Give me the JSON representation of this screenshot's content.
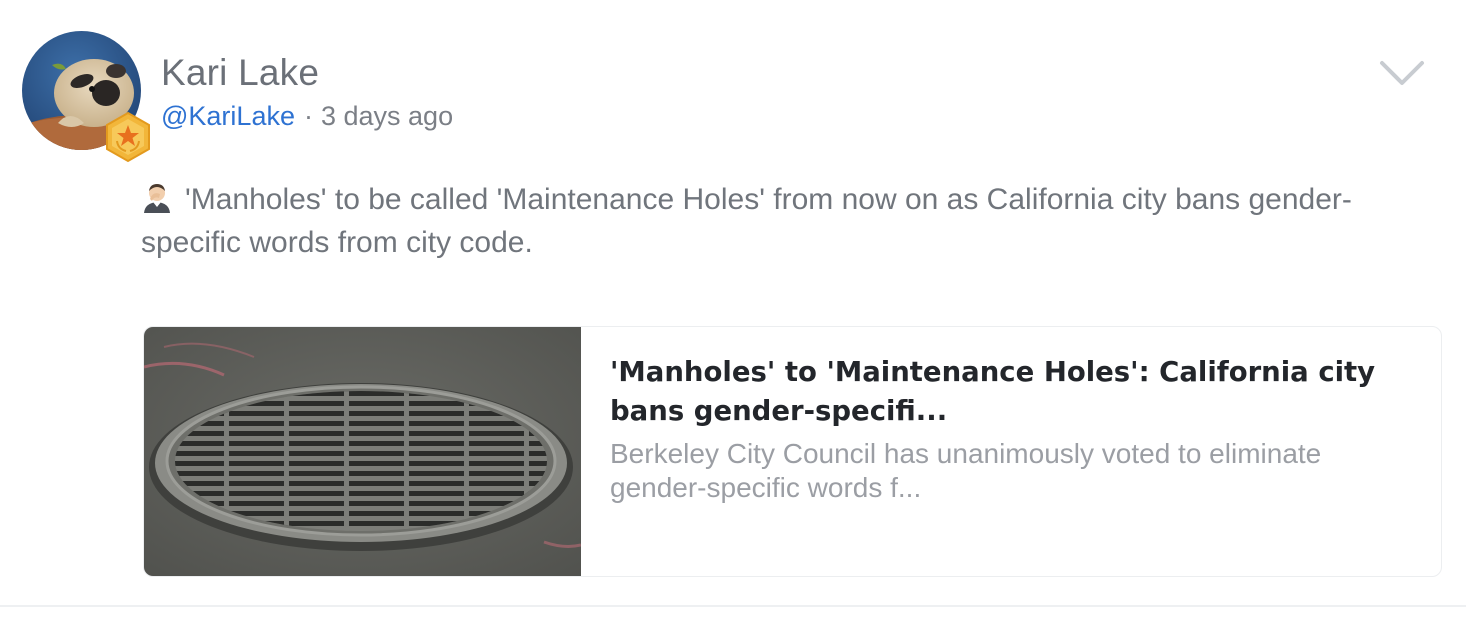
{
  "post": {
    "author_name": "Kari Lake",
    "handle": "@KariLake",
    "separator": "·",
    "timestamp": "3 days ago",
    "text": "'Manholes' to be called 'Maintenance Holes' from now on as California city bans gender-specific words from city code.",
    "text_emoji": "man-facepalming-emoji",
    "badge": "gold-star-badge-icon",
    "menu_icon": "chevron-down-icon"
  },
  "link_card": {
    "title": "'Manholes' to 'Maintenance Holes': California city bans gender-specifi...",
    "description": "Berkeley City Council has unanimously voted to eliminate gender-specific words f...",
    "image": "manhole-cover-photo"
  },
  "colors": {
    "handle": "#2e72d2",
    "name": "#6b7078",
    "body_text": "#70757c",
    "card_title": "#23262b",
    "card_desc": "#9b9ea4",
    "badge_gold": "#f2b63a"
  }
}
